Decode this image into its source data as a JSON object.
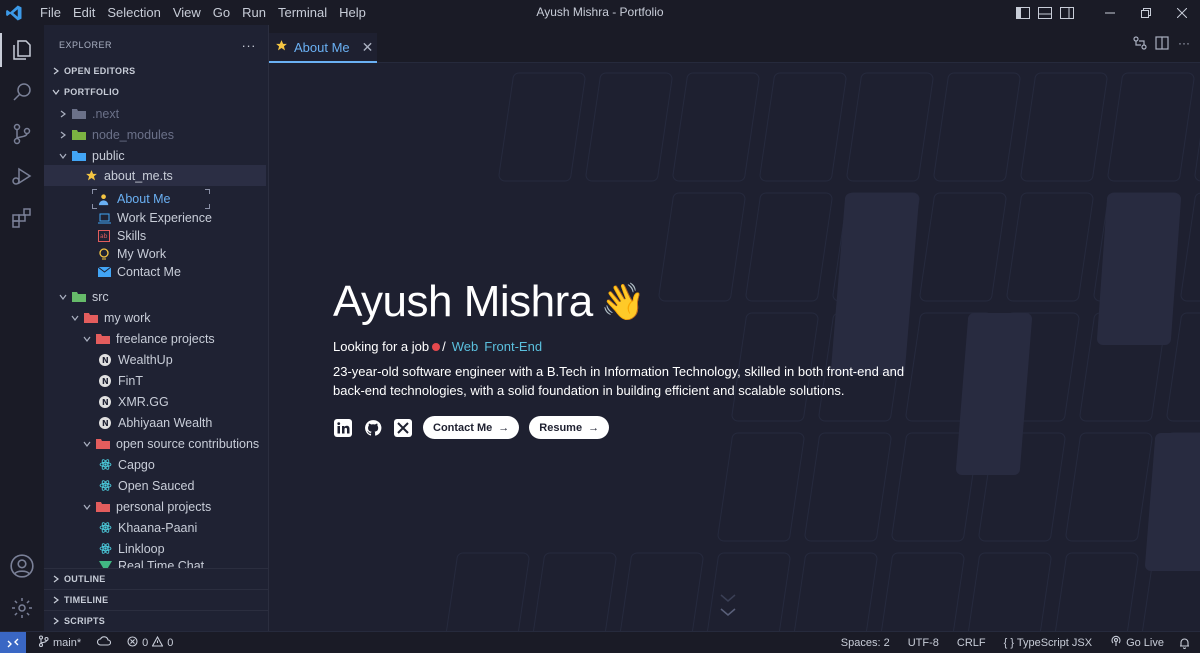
{
  "window": {
    "title": "Ayush Mishra - Portfolio",
    "menus": [
      "File",
      "Edit",
      "Selection",
      "View",
      "Go",
      "Run",
      "Terminal",
      "Help"
    ]
  },
  "sidebar": {
    "explorer_label": "EXPLORER",
    "more": "···",
    "open_editors": "OPEN EDITORS",
    "portfolio": "PORTFOLIO",
    "tree": {
      "next": ".next",
      "node_modules": "node_modules",
      "public": "public",
      "about_file": "about_me.ts",
      "about_items": [
        "About Me",
        "Work Experience",
        "Skills",
        "My Work",
        "Contact Me"
      ],
      "src": "src",
      "my_work": "my work",
      "freelance": "freelance projects",
      "freelance_items": [
        "WealthUp",
        "FinT",
        "XMR.GG",
        "Abhiyaan Wealth"
      ],
      "open_source": "open source contributions",
      "open_source_items": [
        "Capgo",
        "Open Sauced"
      ],
      "personal": "personal projects",
      "personal_items": [
        "Khaana-Paani",
        "Linkloop",
        "Real Time Chat"
      ]
    },
    "outline": "OUTLINE",
    "timeline": "TIMELINE",
    "scripts": "SCRIPTS"
  },
  "editor": {
    "tab_label": "About Me",
    "tab_close": "✕",
    "name": "Ayush Mishra",
    "wave": "👋",
    "looking": "Looking for a job",
    "separator": "/",
    "role_1": "Web",
    "role_2": "Front-End",
    "bio": "23-year-old software engineer with a B.Tech in Information Technology, skilled in both front-end and back-end technologies, with a solid foundation in building efficient and scalable solutions.",
    "contact_button": "Contact Me",
    "resume_button": "Resume",
    "arrow": "→"
  },
  "status": {
    "branch": "main*",
    "errors": "0",
    "warnings": "0",
    "spaces": "Spaces: 2",
    "encoding": "UTF-8",
    "eol": "CRLF",
    "language": "{ } TypeScript JSX",
    "golive": "Go Live"
  },
  "colors": {
    "accent": "#6ab0f3",
    "background": "#1e2030",
    "sidebar": "#1f2233",
    "remote": "#3a67c4",
    "status_dot": "#e5484d",
    "role": "#5bc0de"
  }
}
